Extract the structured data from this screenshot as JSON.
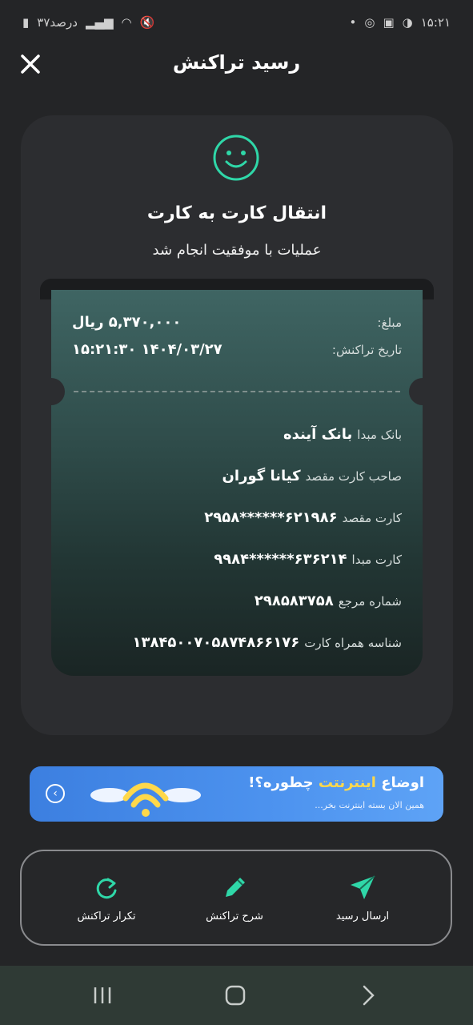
{
  "status_bar": {
    "time": "۱۵:۲۱",
    "battery": "۳۷درصد"
  },
  "header": {
    "title": "رسید تراکنش"
  },
  "receipt": {
    "transfer_title": "انتقال کارت به کارت",
    "success_message": "عملیات با موفقیت انجام شد",
    "amount_label": "مبلغ:",
    "amount_value": "۵,۳۷۰,۰۰۰ ریال",
    "date_label": "تاریخ تراکنش:",
    "date_value": "۱۴۰۴/۰۳/۲۷ ۱۵:۲۱:۳۰",
    "details": [
      {
        "label": "بانک مبدا",
        "value": "بانک آینده"
      },
      {
        "label": "صاحب کارت مقصد",
        "value": "کیانا گوران"
      },
      {
        "label": "کارت مقصد",
        "value": "۶۲۱۹۸۶******۲۹۵۸"
      },
      {
        "label": "کارت مبدا",
        "value": "۶۳۶۲۱۴******۹۹۸۴"
      },
      {
        "label": "شماره مرجع",
        "value": "۲۹۸۵۸۳۷۵۸"
      },
      {
        "label": "شناسه همراه کارت",
        "value": "۱۳۸۴۵۰۰۷۰۵۸۷۴۸۶۶۱۷۶"
      }
    ]
  },
  "banner": {
    "title_prefix": "اوضاع",
    "title_highlight": "اینترنتت",
    "title_suffix": "چطوره؟!",
    "subtitle": "همین الان بسته اینترنت بخر..."
  },
  "actions": [
    {
      "label": "ارسال رسید",
      "icon": "send-icon"
    },
    {
      "label": "شرح تراکنش",
      "icon": "pencil-icon"
    },
    {
      "label": "تکرار تراکنش",
      "icon": "repeat-icon"
    }
  ],
  "colors": {
    "accent": "#2fd7a8",
    "background": "#242527",
    "card": "#2c2d30",
    "banner": "#4d93ef"
  }
}
